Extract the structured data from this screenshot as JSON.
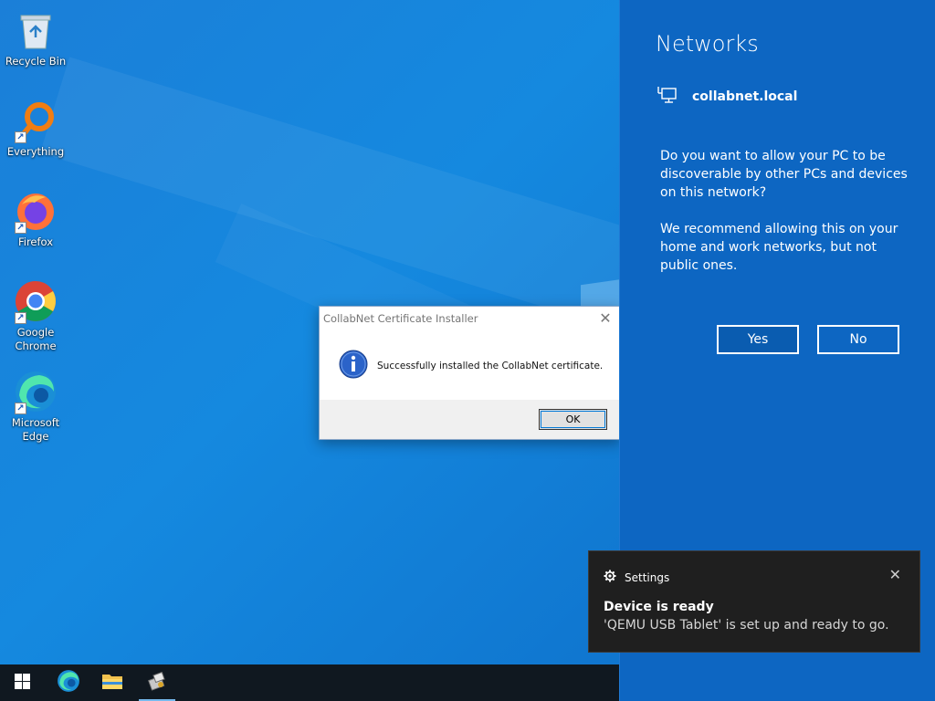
{
  "desktop": {
    "icons": [
      {
        "label": "Recycle Bin",
        "icon": "recycle-bin-icon"
      },
      {
        "label": "Everything",
        "icon": "everything-search-icon"
      },
      {
        "label": "Firefox",
        "icon": "firefox-icon"
      },
      {
        "label": "Google\nChrome",
        "icon": "chrome-icon"
      },
      {
        "label": "Microsoft\nEdge",
        "icon": "edge-icon"
      }
    ]
  },
  "dialog": {
    "title": "CollabNet Certificate Installer",
    "message": "Successfully installed the CollabNet certificate.",
    "ok_label": "OK",
    "icon": "info-icon"
  },
  "network_panel": {
    "title": "Networks",
    "network_name": "collabnet.local",
    "question": "Do you want to allow your PC to be discoverable by other PCs and devices on this network?",
    "recommendation": "We recommend allowing this on your home and work networks, but not public ones.",
    "yes_label": "Yes",
    "no_label": "No"
  },
  "toast": {
    "app_name": "Settings",
    "title": "Device is ready",
    "message": "'QEMU USB Tablet' is set up and ready to go."
  },
  "taskbar": {
    "items": [
      "start-icon",
      "edge-icon",
      "file-explorer-icon",
      "certificate-installer-icon"
    ],
    "active_item": "certificate-installer-icon"
  },
  "colors": {
    "desktop_blue": "#1589df",
    "panel_blue": "#0d66c2",
    "taskbar": "#101820",
    "toast_bg": "#1f1f1f",
    "accent": "#0078d7"
  }
}
